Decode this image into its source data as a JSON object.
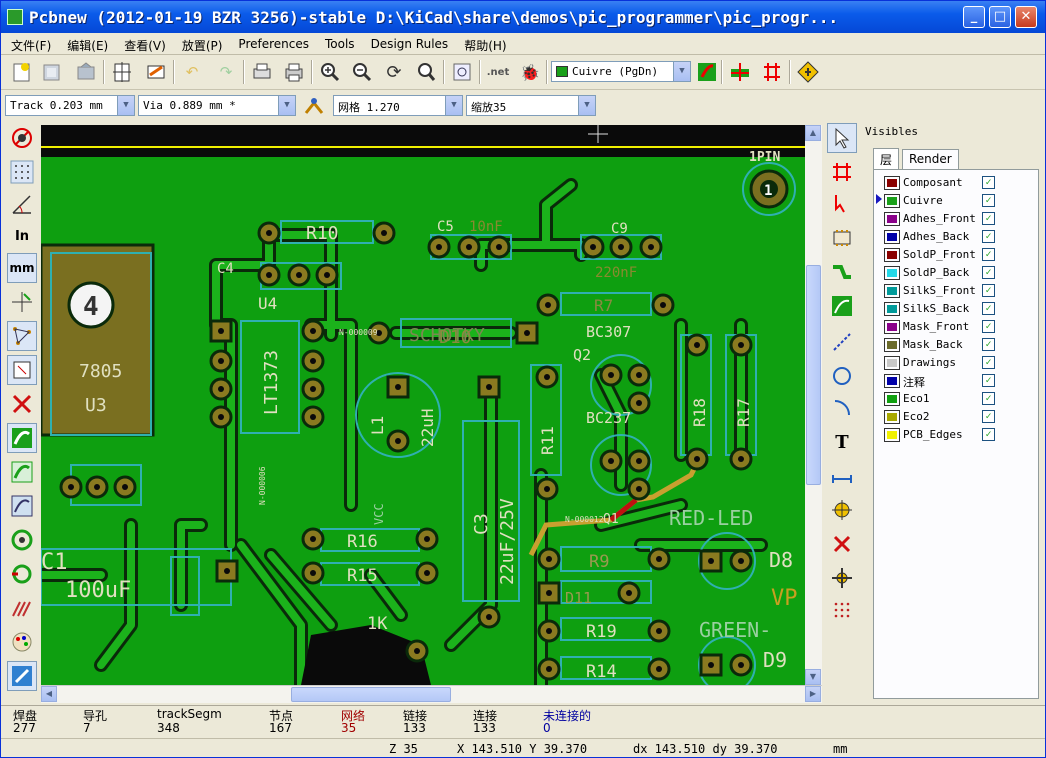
{
  "window": {
    "title": "Pcbnew (2012-01-19 BZR 3256)-stable D:\\KiCad\\share\\demos\\pic_programmer\\pic_progr...",
    "minimize": "_",
    "maximize": "□",
    "close": "✕"
  },
  "menu": [
    "文件(F)",
    "编辑(E)",
    "查看(V)",
    "放置(P)",
    "Preferences",
    "Tools",
    "Design Rules",
    "帮助(H)"
  ],
  "toolbar": {
    "layer_select": "Cuivre (PgDn)",
    "layer_color": "#1aa01a",
    "track_width": "Track 0.203 mm",
    "via_size": "Via 0.889 mm *",
    "grid_label": "网格 1.270",
    "zoom_label": "缩放35"
  },
  "panel": {
    "title": "Visibles",
    "tabs": [
      "层",
      "Render"
    ],
    "layers": [
      {
        "name": "Composant",
        "color": "#8a0000",
        "checked": "✓"
      },
      {
        "name": "Cuivre",
        "color": "#1aa01a",
        "checked": "✓"
      },
      {
        "name": "Adhes_Front",
        "color": "#8a008a",
        "checked": "✓"
      },
      {
        "name": "Adhes_Back",
        "color": "#0000a8",
        "checked": "✓"
      },
      {
        "name": "SoldP_Front",
        "color": "#8a0000",
        "checked": "✓"
      },
      {
        "name": "SoldP_Back",
        "color": "#22d8e8",
        "checked": "✓"
      },
      {
        "name": "SilkS_Front",
        "color": "#009a9a",
        "checked": "✓"
      },
      {
        "name": "SilkS_Back",
        "color": "#009a9a",
        "checked": "✓"
      },
      {
        "name": "Mask_Front",
        "color": "#8a008a",
        "checked": "✓"
      },
      {
        "name": "Mask_Back",
        "color": "#6a6a2a",
        "checked": "✓"
      },
      {
        "name": "Drawings",
        "color": "#c8c8c8",
        "checked": "✓"
      },
      {
        "name": "注释",
        "color": "#0000a8",
        "checked": "✓"
      },
      {
        "name": "Eco1",
        "color": "#10a010",
        "checked": "✓"
      },
      {
        "name": "Eco2",
        "color": "#a8a800",
        "checked": "✓"
      },
      {
        "name": "PCB_Edges",
        "color": "#f0f000",
        "checked": "✓"
      }
    ]
  },
  "status": [
    {
      "label": "焊盘",
      "value": "277",
      "color": "#000"
    },
    {
      "label": "导孔",
      "value": "7",
      "color": "#000"
    },
    {
      "label": "trackSegm",
      "value": "348",
      "color": "#000"
    },
    {
      "label": "节点",
      "value": "167",
      "color": "#000"
    },
    {
      "label": "网络",
      "value": "35",
      "color": "#a00000"
    },
    {
      "label": "链接",
      "value": "133",
      "color": "#000"
    },
    {
      "label": "连接",
      "value": "133",
      "color": "#000"
    },
    {
      "label": "未连接的",
      "value": "0",
      "color": "#0000a0"
    }
  ],
  "coords": {
    "zoom": "Z 35",
    "xy": "X 143.510  Y 39.370",
    "dxy": "dx 143.510  dy 39.370",
    "units": "mm"
  },
  "pcb": {
    "labels": [
      "R10",
      "C5",
      "10nF",
      "C9",
      "220nF",
      "C4",
      "U4",
      "LT1373",
      "7805",
      "U3",
      "SCHOTKY",
      "D10",
      "R7",
      "BC307",
      "Q2",
      "BC237",
      "R11",
      "R18",
      "R17",
      "L1",
      "22uH",
      "C3",
      "22uF/25V",
      "R16",
      "R15",
      "1K",
      "C1",
      "100uF",
      "RED-LED",
      "D8",
      "R9",
      "D11",
      "R19",
      "R14",
      "GREEN-",
      "D9",
      "1PIN",
      "1",
      "4",
      "Q1",
      "VP",
      "VCC",
      "N-000009",
      "N-000012",
      "N-000006"
    ]
  }
}
